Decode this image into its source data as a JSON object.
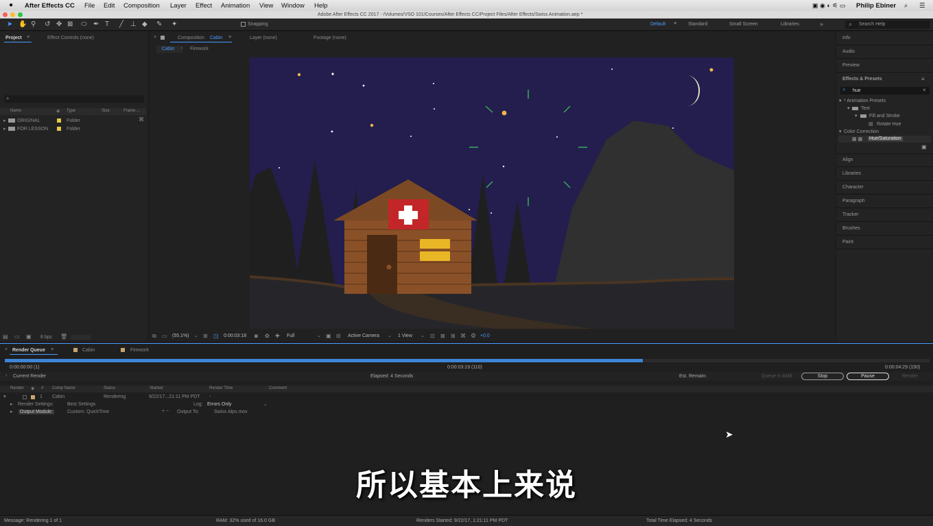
{
  "menubar": {
    "app": "After Effects CC",
    "items": [
      "File",
      "Edit",
      "Composition",
      "Layer",
      "Effect",
      "Animation",
      "View",
      "Window",
      "Help"
    ],
    "user": "Philip Ebiner"
  },
  "window": {
    "title": "Adobe After Effects CC 2017 - /Volumes/VSO 101/Courses/After Effects CC/Project Files/After Effects/Swiss Animation.aep *"
  },
  "toolbar": {
    "snapping": "Snapping",
    "workspaces": [
      "Default",
      "Standard",
      "Small Screen",
      "Libraries"
    ],
    "search": "Search Help"
  },
  "project": {
    "tab": "Project",
    "effect_controls": "Effect Controls (none)",
    "columns": [
      "Name",
      "Type",
      "Size",
      "Frame ..."
    ],
    "items": [
      {
        "name": "ORIGINAL",
        "type": "Folder"
      },
      {
        "name": "FOR LESSON",
        "type": "Folder"
      }
    ],
    "bpc": "8 bpc"
  },
  "composition": {
    "tab_prefix": "Composition",
    "tab_name": "Cabin",
    "layer_tab": "Layer (none)",
    "footage_tab": "Footage (none)",
    "breadcrumb": [
      "Cabin",
      "Firework"
    ],
    "zoom": "(55.1%)",
    "timecode": "0:00:03:18",
    "resolution": "Full",
    "camera": "Active Camera",
    "view": "1 View",
    "exposure": "+0.0"
  },
  "right_panel": {
    "items_top": [
      "Info",
      "Audio",
      "Preview"
    ],
    "effects_title": "Effects & Presets",
    "search": "hue",
    "tree": [
      "* Animation Presets",
      "Text",
      "Fill and Stroke",
      "Rotate Hue",
      "Color Correction",
      "Hue/Saturation"
    ],
    "items_bottom": [
      "Align",
      "Libraries",
      "Character",
      "Paragraph",
      "Tracker",
      "Brushes",
      "Paint"
    ]
  },
  "render_queue": {
    "tab": "Render Queue",
    "comp_tabs": [
      "Cabin",
      "Firework"
    ],
    "progress": 0.69,
    "time_start": "0:00:00:00 (1)",
    "time_current": "0:00:03:19 (110)",
    "time_end": "0:00:04:29 (150)",
    "current_render": "Current Render",
    "elapsed": "Elapsed: 4 Seconds",
    "remain": "Est. Remain:",
    "queue_ame": "Queue in AME",
    "stop": "Stop",
    "pause": "Pause",
    "render": "Render",
    "columns": [
      "Render",
      "#",
      "Comp Name",
      "Status",
      "Started",
      "Render Time",
      "Comment"
    ],
    "row": {
      "num": "1",
      "comp": "Cabin",
      "status": "Rendering",
      "started": "9/22/17...21:11 PM PDT",
      "time": "-"
    },
    "render_settings_label": "Render Settings:",
    "render_settings_value": "Best Settings",
    "log_label": "Log:",
    "log_value": "Errors Only",
    "output_module_label": "Output Module:",
    "output_module_value": "Custom: QuickTime",
    "output_to_label": "Output To:",
    "output_to_value": "Swiss Alps.mov"
  },
  "subtitle": "所以基本上来说",
  "status": {
    "message": "Message: Rendering 1 of 1",
    "ram": "RAM: 32% used of 16.0 GB",
    "started": "Renders Started: 9/22/17, 1:21:11 PM PDT",
    "total": "Total Time Elapsed: 4 Seconds"
  }
}
